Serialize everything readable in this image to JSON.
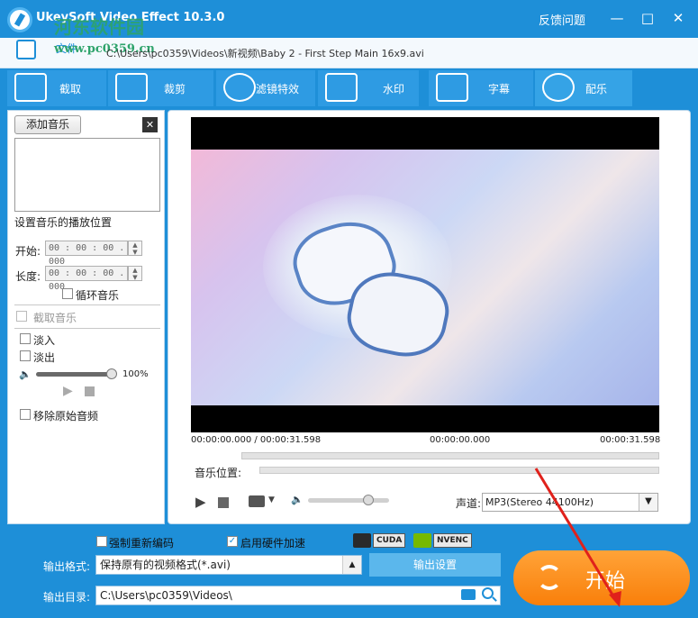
{
  "titlebar": {
    "app_title": "UkeySoft Video Effect 10.3.0",
    "watermark_cn": "河东软件园",
    "feedback": "反馈问题",
    "minimize": "—",
    "maximize": "□",
    "close": "✕"
  },
  "file": {
    "label": "文件",
    "watermark_site": "www.pc0359.cn",
    "path": "C:\\Users\\pc0359\\Videos\\新视频\\Baby 2 - First Step Main 16x9.avi"
  },
  "tabs": [
    {
      "label": "截取",
      "icon": "scissors-icon"
    },
    {
      "label": "裁剪",
      "icon": "crop-icon"
    },
    {
      "label": "滤镜特效",
      "icon": "stars-icon"
    },
    {
      "label": "水印",
      "icon": "droplet-icon"
    },
    {
      "label": "字幕",
      "icon": "subtitle-icon"
    },
    {
      "label": "配乐",
      "icon": "music-icon"
    }
  ],
  "active_tab": "配乐",
  "music": {
    "add_button": "添加音乐",
    "close_glyph": "✕",
    "position_heading": "设置音乐的播放位置",
    "start_label": "开始:",
    "start_value": "00 : 00 : 00 . 000",
    "length_label": "长度:",
    "length_value": "00 : 00 : 00 . 000",
    "loop_label": "循环音乐",
    "trim_label": "截取音乐",
    "fade_in_label": "淡入",
    "fade_out_label": "淡出",
    "volume_percent": "100%",
    "volume_level": 1.0,
    "remove_original_label": "移除原始音频"
  },
  "player": {
    "time_left": "00:00:00.000 / 00:00:31.598",
    "time_mid": "00:00:00.000",
    "time_end": "00:00:31.598",
    "music_position_label": "音乐位置:",
    "channel_label": "声道:",
    "channel_value": "MP3(Stereo 44100Hz)",
    "volume_level": 0.72
  },
  "output": {
    "reencode_label": "强制重新编码",
    "reencode_checked": false,
    "hwaccel_label": "启用硬件加速",
    "hwaccel_checked": true,
    "cuda_badge": "CUDA",
    "nvenc_badge": "NVENC",
    "format_label": "输出格式:",
    "format_value": "保持原有的视频格式(*.avi)",
    "settings_button": "输出设置",
    "dir_label": "输出目录:",
    "dir_value": "C:\\Users\\pc0359\\Videos\\",
    "start_button": "开始"
  },
  "colors": {
    "brand_blue": "#1e8fd8",
    "start_orange": "#f98d1f",
    "arrow_red": "#e0211b"
  }
}
